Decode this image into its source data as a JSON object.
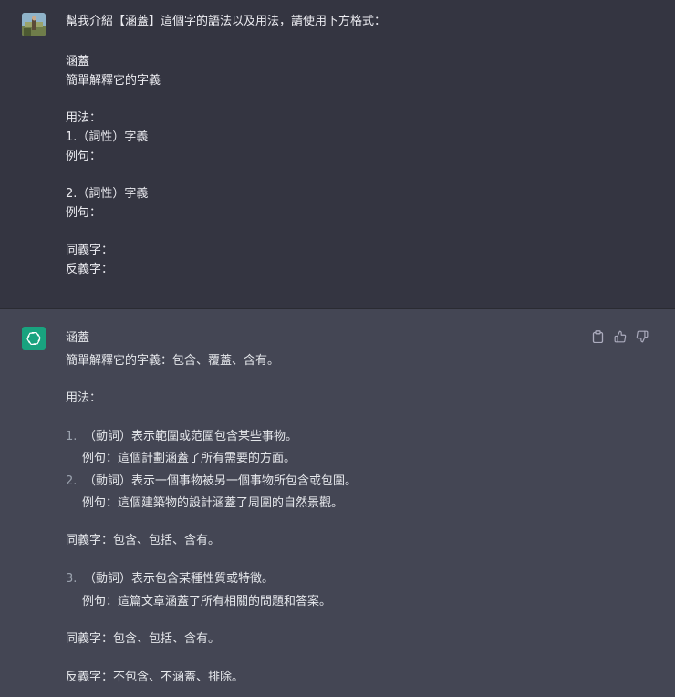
{
  "user_message": {
    "lines": [
      "幫我介紹【涵蓋】這個字的語法以及用法，請使用下方格式：",
      "涵蓋",
      "簡單解釋它的字義",
      "用法：",
      "1.（詞性）字義",
      "例句：",
      "2.（詞性）字義",
      "例句：",
      "同義字：",
      "反義字："
    ]
  },
  "assistant_message": {
    "word": "涵蓋",
    "definition": "簡單解釋它的字義：包含、覆蓋、含有。",
    "usage_heading": "用法：",
    "items": [
      {
        "number": "1.",
        "text": "（動詞）表示範圍或范圍包含某些事物。",
        "example": "例句：這個計劃涵蓋了所有需要的方面。"
      },
      {
        "number": "2.",
        "text": "（動詞）表示一個事物被另一個事物所包含或包圍。",
        "example": "例句：這個建築物的設計涵蓋了周圍的自然景觀。"
      }
    ],
    "synonyms_1": "同義字：包含、包括、含有。",
    "item_3": {
      "number": "3.",
      "text": "（動詞）表示包含某種性質或特徵。",
      "example": "例句：這篇文章涵蓋了所有相關的問題和答案。"
    },
    "synonyms_2": "同義字：包含、包括、含有。",
    "antonyms": "反義字：不包含、不涵蓋、排除。"
  },
  "icons": {
    "user_avatar": "user-avatar-photo",
    "bot_avatar": "openai-logo-icon",
    "copy": "clipboard-icon",
    "like": "thumbs-up-icon",
    "dislike": "thumbs-down-icon"
  },
  "colors": {
    "user_bg": "#343541",
    "assistant_bg": "#444654",
    "bot_avatar_bg": "#19a37f",
    "text": "#d1d5db"
  }
}
